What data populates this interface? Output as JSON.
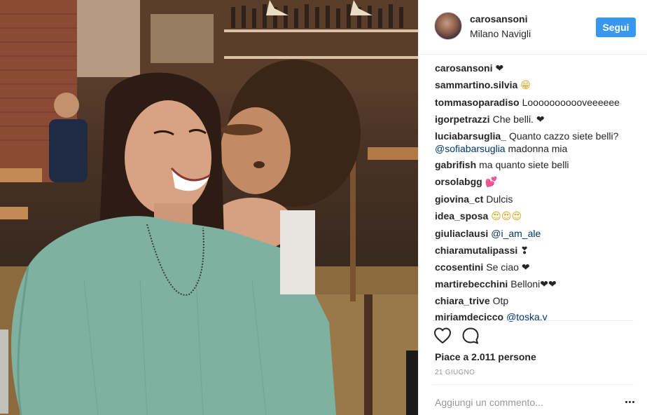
{
  "header": {
    "username": "carosansoni",
    "location": "Milano Navigli",
    "follow_label": "Segui"
  },
  "comments": [
    {
      "user": "carosansoni",
      "parts": [
        {
          "t": "text",
          "v": "❤"
        }
      ]
    },
    {
      "user": "sammartino.silvia",
      "parts": [
        {
          "t": "emoji",
          "v": "😁",
          "c": "yellow"
        }
      ]
    },
    {
      "user": "tommasoparadiso",
      "parts": [
        {
          "t": "text",
          "v": "Looooooooooveeeeee"
        }
      ]
    },
    {
      "user": "igorpetrazzi",
      "parts": [
        {
          "t": "text",
          "v": "Che belli. ❤"
        }
      ]
    },
    {
      "user": "luciabarsuglia_",
      "parts": [
        {
          "t": "text",
          "v": "Quanto cazzo siete belli? "
        },
        {
          "t": "mention",
          "v": "@sofiabarsuglia"
        },
        {
          "t": "text",
          "v": " madonna mia"
        }
      ]
    },
    {
      "user": "gabrifish",
      "parts": [
        {
          "t": "text",
          "v": "ma quanto siete belli"
        }
      ]
    },
    {
      "user": "orsolabgg",
      "parts": [
        {
          "t": "emoji",
          "v": "💕",
          "c": "pink"
        }
      ]
    },
    {
      "user": "giovina_ct",
      "parts": [
        {
          "t": "text",
          "v": "Dulcis"
        }
      ]
    },
    {
      "user": "idea_sposa",
      "parts": [
        {
          "t": "emoji",
          "v": "😍😍😍",
          "c": "yellow"
        }
      ]
    },
    {
      "user": "giuliaclausi",
      "parts": [
        {
          "t": "mention",
          "v": "@i_am_ale"
        }
      ]
    },
    {
      "user": "chiaramutalipassi",
      "parts": [
        {
          "t": "text",
          "v": "❣"
        }
      ]
    },
    {
      "user": "ccosentini",
      "parts": [
        {
          "t": "text",
          "v": "Se ciao ❤"
        }
      ]
    },
    {
      "user": "martirebecchini",
      "parts": [
        {
          "t": "text",
          "v": "Belloni❤❤"
        }
      ]
    },
    {
      "user": "chiara_trive",
      "parts": [
        {
          "t": "text",
          "v": "Otp"
        }
      ]
    },
    {
      "user": "miriamdecicco",
      "parts": [
        {
          "t": "mention",
          "v": "@toska.v"
        }
      ]
    }
  ],
  "actions": {
    "like_icon": "heart-outline-icon",
    "comment_icon": "speech-bubble-icon"
  },
  "likes_text": "Piace a 2.011 persone",
  "date_text": "21 GIUGNO",
  "add_comment_placeholder": "Aggiungi un commento...",
  "more_icon": "more-dots-icon",
  "colors": {
    "accent": "#3897f0",
    "mention": "#003569",
    "muted": "#999999",
    "border": "#efefef"
  }
}
